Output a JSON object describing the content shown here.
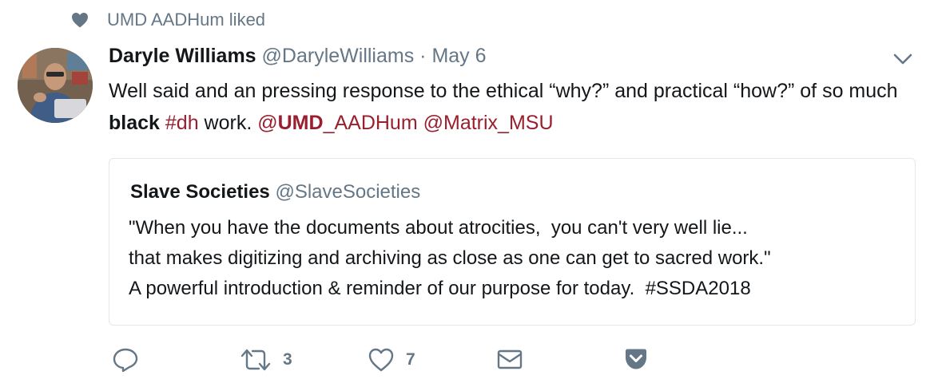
{
  "social_context": {
    "text": "UMD AADHum liked"
  },
  "tweet": {
    "author_name": "Daryle Williams",
    "author_handle": "@DaryleWilliams",
    "separator": "·",
    "date": "May 6",
    "text_parts": {
      "p1": "Well said and an pressing response to the ethical “why?” and practical “how?” of so much ",
      "p2": "black",
      "p3": " ",
      "hashtag_dh": "#dh",
      "p4": " work. ",
      "mention1_at": "@",
      "mention1_bold": "UMD",
      "mention1_rest": "_AADHum",
      "p5": " ",
      "mention2": "@Matrix_MSU"
    }
  },
  "quoted": {
    "name": "Slave Societies",
    "handle": "@SlaveSocieties",
    "lines": [
      "\"When you have the documents about atrocities,  you can't very well lie...",
      "that makes digitizing and archiving as close as one can get to sacred work.\"",
      "A powerful introduction & reminder of our purpose for today.  #SSDA2018"
    ]
  },
  "actions": {
    "reply": {
      "icon": "reply-icon"
    },
    "retweet": {
      "icon": "retweet-icon",
      "count": "3"
    },
    "like": {
      "icon": "heart-icon",
      "count": "7"
    },
    "dm": {
      "icon": "envelope-icon"
    },
    "pocket": {
      "icon": "pocket-icon"
    }
  },
  "colors": {
    "text": "#14171a",
    "muted": "#657786",
    "link": "#9a1f2e",
    "border": "#e1e8ed"
  }
}
